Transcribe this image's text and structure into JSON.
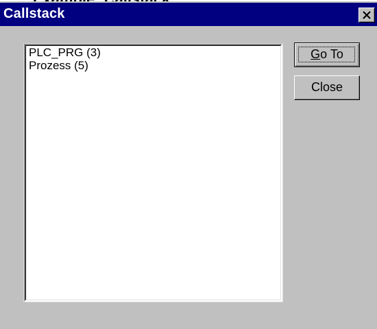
{
  "window": {
    "title": "Callstack",
    "cutoff_heading": "Example: Callstack"
  },
  "callstack": {
    "items": [
      "PLC_PRG (3)",
      "Prozess (5)"
    ]
  },
  "buttons": {
    "goto_accel": "G",
    "goto_rest": "o To",
    "close_label": "Close"
  },
  "icons": {
    "close": "close-icon"
  }
}
